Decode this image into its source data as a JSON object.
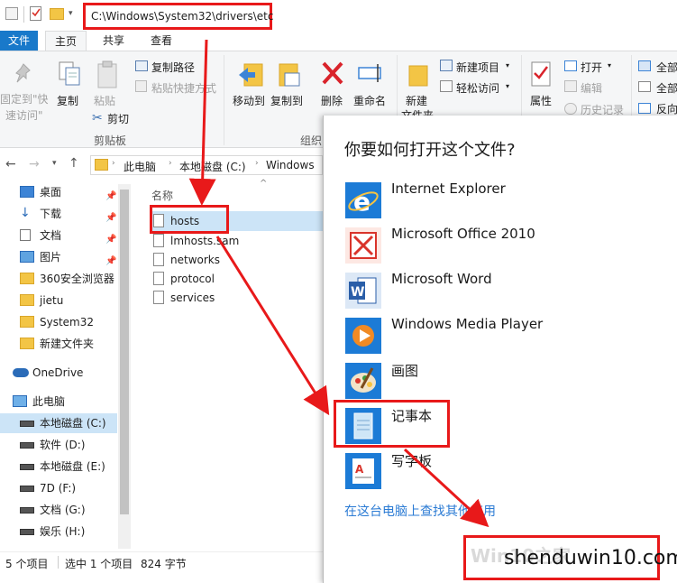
{
  "address_path": "C:\\Windows\\System32\\drivers\\etc",
  "ribbon_tabs": {
    "file": "文件",
    "home": "主页",
    "share": "共享",
    "view": "查看"
  },
  "ribbon": {
    "pin_quick_access_1": "固定到\"快",
    "pin_quick_access_2": "速访问\"",
    "copy": "复制",
    "paste": "粘贴",
    "copy_path": "复制路径",
    "paste_shortcut": "粘贴快捷方式",
    "cut": "剪切",
    "group_clipboard": "剪贴板",
    "move_to": "移动到",
    "copy_to": "复制到",
    "delete": "删除",
    "rename": "重命名",
    "group_organize": "组织",
    "new_folder_1": "新建",
    "new_folder_2": "文件夹",
    "new_item": "新建项目",
    "easy_access": "轻松访问",
    "properties": "属性",
    "open": "打开",
    "edit": "编辑",
    "history": "历史记录",
    "select_all": "全部",
    "select_none": "全部",
    "invert": "反向"
  },
  "breadcrumb": [
    "此电脑",
    "本地磁盘 (C:)",
    "Windows"
  ],
  "nav_pane": [
    {
      "label": "桌面",
      "icon": "desktop-icon",
      "pinned": true
    },
    {
      "label": "下载",
      "icon": "download-icon",
      "pinned": true
    },
    {
      "label": "文档",
      "icon": "documents-icon",
      "pinned": true
    },
    {
      "label": "图片",
      "icon": "pictures-icon",
      "pinned": true
    },
    {
      "label": "360安全浏览器",
      "icon": "folder-icon",
      "pinned": false
    },
    {
      "label": "jietu",
      "icon": "folder-icon",
      "pinned": false
    },
    {
      "label": "System32",
      "icon": "folder-icon",
      "pinned": false
    },
    {
      "label": "新建文件夹",
      "icon": "folder-icon",
      "pinned": false
    },
    {
      "label": "OneDrive",
      "icon": "onedrive-icon",
      "pinned": false
    },
    {
      "label": "此电脑",
      "icon": "computer-icon",
      "pinned": false
    },
    {
      "label": "本地磁盘 (C:)",
      "icon": "drive-icon",
      "pinned": false
    },
    {
      "label": "软件 (D:)",
      "icon": "drive-icon",
      "pinned": false
    },
    {
      "label": "本地磁盘 (E:)",
      "icon": "drive-icon",
      "pinned": false
    },
    {
      "label": "7D (F:)",
      "icon": "drive-icon",
      "pinned": false
    },
    {
      "label": "文档 (G:)",
      "icon": "drive-icon",
      "pinned": false
    },
    {
      "label": "娱乐 (H:)",
      "icon": "drive-icon",
      "pinned": false
    }
  ],
  "file_list": {
    "column_name": "名称",
    "files": [
      "hosts",
      "lmhosts.sam",
      "networks",
      "protocol",
      "services"
    ]
  },
  "status": {
    "items": "5 个项目",
    "selected": "选中 1 个项目",
    "size": "824 字节"
  },
  "open_with_dialog": {
    "title": "你要如何打开这个文件?",
    "apps": [
      {
        "name": "Internet Explorer",
        "icon": "internet-explorer-icon"
      },
      {
        "name": "Microsoft Office 2010",
        "icon": "office-icon"
      },
      {
        "name": "Microsoft Word",
        "icon": "word-icon"
      },
      {
        "name": "Windows Media Player",
        "icon": "media-player-icon"
      },
      {
        "name": "画图",
        "icon": "paint-icon"
      },
      {
        "name": "记事本",
        "icon": "notepad-icon"
      },
      {
        "name": "写字板",
        "icon": "wordpad-icon"
      }
    ],
    "more_apps_link": "在这台电脑上查找其他应用"
  },
  "watermark": {
    "text": "shenduwin10.com",
    "faded": "Win10之家"
  },
  "colors": {
    "accent": "#1979ca",
    "annotation": "#e8191a",
    "link": "#2b7bd4"
  }
}
